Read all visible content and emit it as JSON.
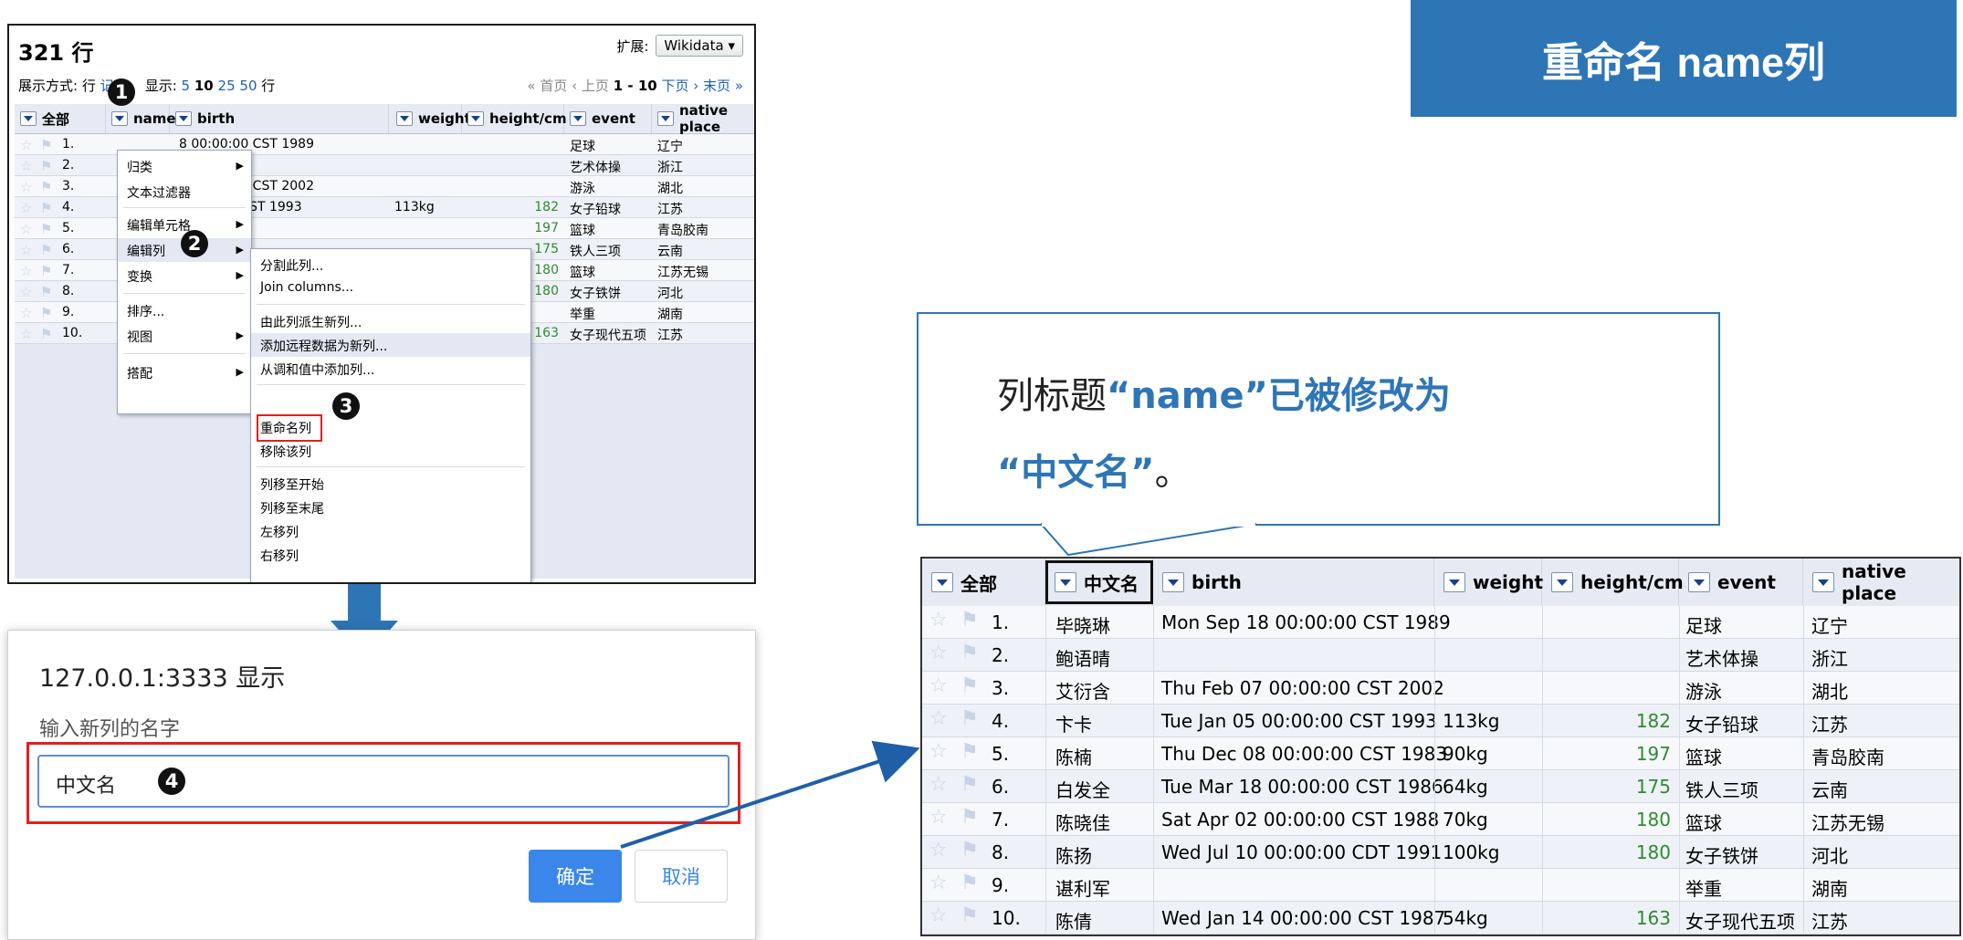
{
  "left_panel": {
    "row_count": "321 行",
    "extend_label": "扩展:",
    "wikidata_select": "Wikidata ▾",
    "view_mode": "展示方式: 行",
    "view_mode_link": "记录",
    "show_label": "显示:",
    "show_options": [
      "5",
      "10",
      "25",
      "50"
    ],
    "show_suffix": "行",
    "pager": {
      "first": "« 首页",
      "prev": "‹ 上页",
      "range": "1 - 10",
      "next": "下页 ›",
      "last": "末页 »"
    },
    "headers": [
      "全部",
      "name",
      "birth",
      "weight",
      "height/cm",
      "event",
      "native place"
    ],
    "rows": [
      {
        "n": "1.",
        "birth": "8 00:00:00 CST 1989",
        "weight": "",
        "height": "",
        "event": "足球",
        "place": "辽宁"
      },
      {
        "n": "2.",
        "birth": "",
        "weight": "",
        "height": "",
        "event": "艺术体操",
        "place": "浙江"
      },
      {
        "n": "3.",
        "birth": "7 00:00:00 CST 2002",
        "weight": "",
        "height": "",
        "event": "游泳",
        "place": "湖北"
      },
      {
        "n": "4.",
        "birth": "00:00:00 CST 1993",
        "weight": "113kg",
        "height": "182",
        "event": "女子铅球",
        "place": "江苏"
      },
      {
        "n": "5.",
        "birth": "",
        "weight": "",
        "height": "197",
        "event": "篮球",
        "place": "青岛胶南"
      },
      {
        "n": "6.",
        "birth": "",
        "weight": "",
        "height": "175",
        "event": "铁人三项",
        "place": "云南"
      },
      {
        "n": "7.",
        "birth": "",
        "weight": "",
        "height": "180",
        "event": "篮球",
        "place": "江苏无锡"
      },
      {
        "n": "8.",
        "birth": "",
        "weight": "",
        "height": "180",
        "event": "女子铁饼",
        "place": "河北"
      },
      {
        "n": "9.",
        "birth": "",
        "weight": "",
        "height": "",
        "event": "举重",
        "place": "湖南"
      },
      {
        "n": "10.",
        "birth": "",
        "weight": "",
        "height": "163",
        "event": "女子现代五项",
        "place": "江苏"
      }
    ],
    "menu1": [
      "归类",
      "文本过滤器",
      "编辑单元格",
      "编辑列",
      "变换",
      "排序...",
      "视图",
      "搭配"
    ],
    "menu2": [
      "分割此列...",
      "Join columns...",
      "由此列派生新列...",
      "添加远程数据为新列...",
      "从调和值中添加列...",
      "重命名列",
      "移除该列",
      "列移至开始",
      "列移至末尾",
      "左移列",
      "右移列"
    ],
    "badges": [
      "1",
      "2",
      "3",
      "4"
    ]
  },
  "dialog": {
    "title": "127.0.0.1:3333 显示",
    "prompt": "输入新列的名字",
    "input_value": "中文名",
    "ok": "确定",
    "cancel": "取消"
  },
  "right": {
    "title": "重命名 name列",
    "callout_part1": "列标题",
    "callout_hl1": "“name”已被修改为",
    "callout_hl2": "“中文名”",
    "callout_part2": "。",
    "headers": [
      "全部",
      "中文名",
      "birth",
      "weight",
      "height/cm",
      "event",
      "native place"
    ],
    "rows": [
      {
        "n": "1.",
        "name": "毕晓琳",
        "birth": "Mon Sep 18 00:00:00 CST 1989",
        "weight": "",
        "height": "",
        "event": "足球",
        "place": "辽宁"
      },
      {
        "n": "2.",
        "name": "鲍语晴",
        "birth": "",
        "weight": "",
        "height": "",
        "event": "艺术体操",
        "place": "浙江"
      },
      {
        "n": "3.",
        "name": "艾衍含",
        "birth": "Thu Feb 07 00:00:00 CST 2002",
        "weight": "",
        "height": "",
        "event": "游泳",
        "place": "湖北"
      },
      {
        "n": "4.",
        "name": "卞卡",
        "birth": "Tue Jan 05 00:00:00 CST 1993",
        "weight": "113kg",
        "height": "182",
        "event": "女子铅球",
        "place": "江苏"
      },
      {
        "n": "5.",
        "name": "陈楠",
        "birth": "Thu Dec 08 00:00:00 CST 1983",
        "weight": "90kg",
        "height": "197",
        "event": "篮球",
        "place": "青岛胶南"
      },
      {
        "n": "6.",
        "name": "白发全",
        "birth": "Tue Mar 18 00:00:00 CST 1986",
        "weight": "64kg",
        "height": "175",
        "event": "铁人三项",
        "place": "云南"
      },
      {
        "n": "7.",
        "name": "陈晓佳",
        "birth": "Sat Apr 02 00:00:00 CST 1988",
        "weight": "70kg",
        "height": "180",
        "event": "篮球",
        "place": "江苏无锡"
      },
      {
        "n": "8.",
        "name": "陈扬",
        "birth": "Wed Jul 10 00:00:00 CDT 1991",
        "weight": "100kg",
        "height": "180",
        "event": "女子铁饼",
        "place": "河北"
      },
      {
        "n": "9.",
        "name": "谌利军",
        "birth": "",
        "weight": "",
        "height": "",
        "event": "举重",
        "place": "湖南"
      },
      {
        "n": "10.",
        "name": "陈倩",
        "birth": "Wed Jan 14 00:00:00 CST 1987",
        "weight": "54kg",
        "height": "163",
        "event": "女子现代五项",
        "place": "江苏"
      }
    ]
  },
  "colors": {
    "accent": "#2e75b6",
    "highlight_red": "#e02020",
    "number_green": "#2e8b2e",
    "link_blue": "#1e5fb4"
  }
}
